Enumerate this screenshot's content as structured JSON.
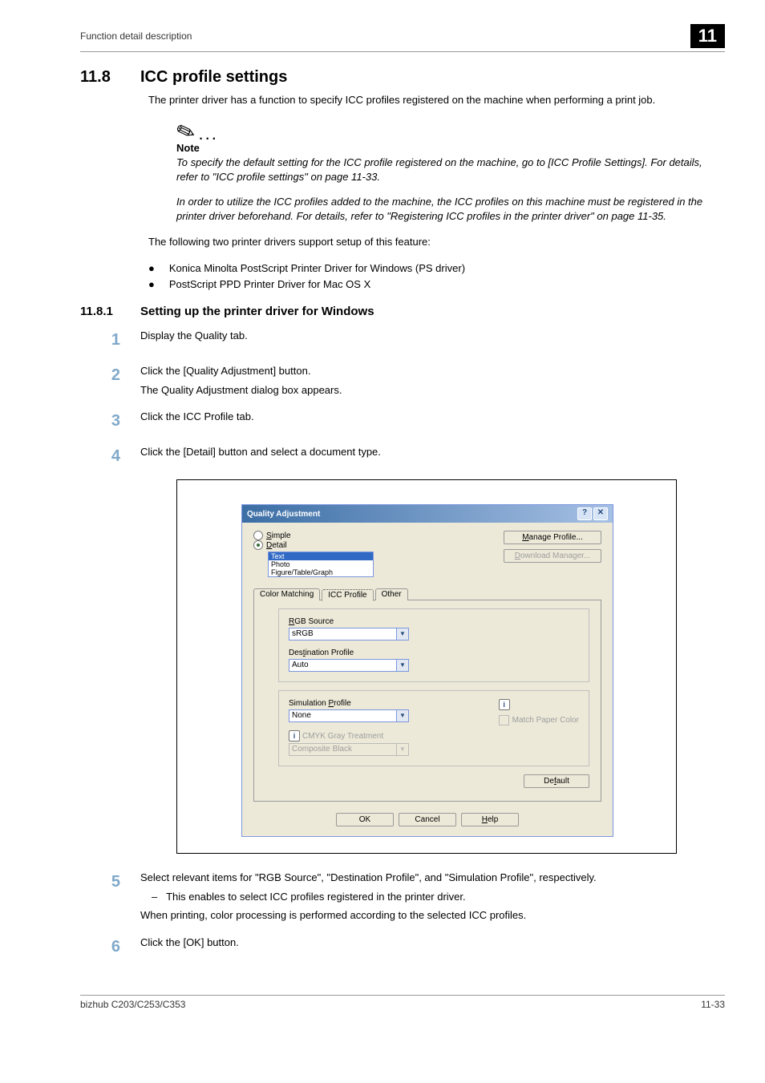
{
  "header": {
    "running_head": "Function detail description",
    "chapter": "11"
  },
  "section": {
    "num": "11.8",
    "title": "ICC profile settings",
    "intro": "The printer driver has a function to specify ICC profiles registered on the machine when performing a print job."
  },
  "note": {
    "label": "Note",
    "p1": "To specify the default setting for the ICC profile registered on the machine, go to [ICC Profile Settings]. For details, refer to \"ICC profile settings\" on page 11-33.",
    "p2": "In order to utilize the ICC profiles added to the machine, the ICC profiles on this machine must be registered in the printer driver beforehand. For details, refer to \"Registering ICC profiles in the printer driver\" on page 11-35."
  },
  "drivers": {
    "lead": "The following two printer drivers support setup of this feature:",
    "items": [
      "Konica Minolta PostScript Printer Driver for Windows (PS driver)",
      "PostScript PPD Printer Driver for Mac OS X"
    ]
  },
  "subsection": {
    "num": "11.8.1",
    "title": "Setting up the printer driver for Windows"
  },
  "steps": {
    "s1": "Display the Quality tab.",
    "s2_a": "Click the [Quality Adjustment] button.",
    "s2_b": "The Quality Adjustment dialog box appears.",
    "s3": "Click the ICC Profile tab.",
    "s4": "Click the [Detail] button and select a document type.",
    "s5_a": "Select relevant items for \"RGB Source\", \"Destination Profile\", and \"Simulation Profile\", respectively.",
    "s5_b": "This enables to select ICC profiles registered in the printer driver.",
    "s5_c": "When printing, color processing is performed according to the selected ICC profiles.",
    "s6": "Click the [OK] button."
  },
  "dialog": {
    "title": "Quality Adjustment",
    "simple": "Simple",
    "detail": "Detail",
    "list": {
      "text": "Text",
      "photo": "Photo",
      "ftg": "Figure/Table/Graph"
    },
    "manage": "Manage Profile...",
    "download": "Download Manager...",
    "tabs": {
      "cm": "Color Matching",
      "icc": "ICC Profile",
      "other": "Other"
    },
    "rgb_label": "RGB Source",
    "rgb_val": "sRGB",
    "dest_label": "Destination Profile",
    "dest_val": "Auto",
    "sim_label": "Simulation Profile",
    "sim_val": "None",
    "match_paper": "Match Paper Color",
    "cmyk_label": "CMYK Gray Treatment",
    "cmyk_val": "Composite Black",
    "default": "Default",
    "ok": "OK",
    "cancel": "Cancel",
    "help": "Help"
  },
  "footer": {
    "left": "bizhub C203/C253/C353",
    "right": "11-33"
  }
}
